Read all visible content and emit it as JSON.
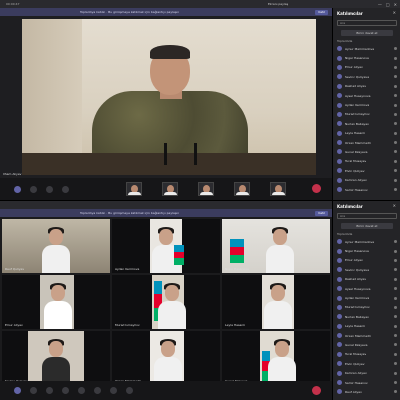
{
  "top_window": {
    "title_left": "00:00:47",
    "title_center": "Ekranı paylaş",
    "window_controls": [
      "—",
      "□",
      "✕"
    ],
    "banner_text": "Toplantıya katılın · Bu görüşmeye katılmak için bağlantıyı paylaşın",
    "banner_button": "Katıl",
    "main_speaker_name": "Ilham Aliyev",
    "panel": {
      "title": "Katılımcılar",
      "search_placeholder": "Ara",
      "invite_label": "Birini davet et",
      "section_label": "Toplantıda",
      "participants": [
        "Aynur Mammadova",
        "Nigar Hasanova",
        "Elnur Aliyev",
        "Sevinc Quliyeva",
        "Rashad Aliyev",
        "Aysel Huseynova",
        "Aydan Kerimova",
        "Murad Ismayilov",
        "Nurlan Babayev",
        "Leyla Hasanli",
        "Orxan Mammadli",
        "Gunel Rzayeva",
        "Tural Musayev",
        "Elvin Quliyev",
        "Kamran Aliyev",
        "Samir Hasanov"
      ]
    },
    "controls": [
      "video-icon",
      "mic-icon",
      "share-icon",
      "more-icon",
      "hangup-icon"
    ]
  },
  "bottom_window": {
    "banner_text": "Toplantıya katılın · Bu görüşmeye katılmak için bağlantıyı paylaşın",
    "banner_button": "Katıl",
    "panel": {
      "title": "Katılımcılar",
      "search_placeholder": "Ara",
      "invite_label": "Birini davet et",
      "section_label": "Toplantıda",
      "participants": [
        "Aynur Mammadova",
        "Nigar Hasanova",
        "Elnur Aliyev",
        "Sevinc Quliyeva",
        "Rashad Aliyev",
        "Aysel Huseynova",
        "Aydan Kerimova",
        "Murad Ismayilov",
        "Nurlan Babayev",
        "Leyla Hasanli",
        "Orxan Mammadli",
        "Gunel Rzayeva",
        "Tural Musayev",
        "Elvin Quliyev",
        "Kamran Aliyev",
        "Samir Hasanov",
        "Rauf Aliyev"
      ]
    },
    "tiles": [
      {
        "name": "Rauf Quliyev"
      },
      {
        "name": "Aydan Kerimova"
      },
      {
        "name": "Nigar Hasanova"
      },
      {
        "name": "Elnur Aliyev"
      },
      {
        "name": "Murad Ismayilov"
      },
      {
        "name": "Leyla Hasanli"
      },
      {
        "name": "Sevinc Quliyeva"
      },
      {
        "name": "Orxan Mammadli"
      },
      {
        "name": "Gunel Rzayeva"
      }
    ],
    "controls": [
      "video-icon",
      "mic-icon",
      "share-icon",
      "more-icon",
      "hangup-icon"
    ]
  },
  "colors": {
    "accent": "#6264a7",
    "hangup": "#c4314b",
    "banner": "#3b3c5e",
    "flag_blue": "#0092bc",
    "flag_red": "#e4002b",
    "flag_green": "#00af66"
  }
}
